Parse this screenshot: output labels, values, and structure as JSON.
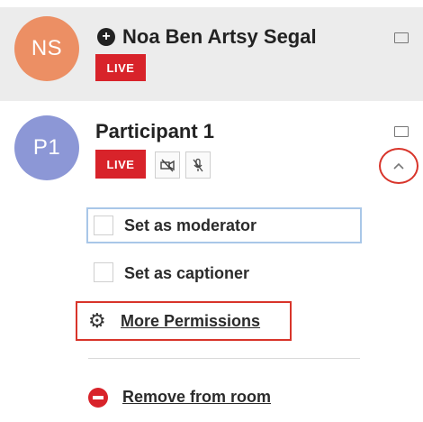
{
  "participants": [
    {
      "initials": "NS",
      "name": "Noa Ben Artsy Segal",
      "status": "LIVE",
      "avatar_color": "#ec8f64"
    },
    {
      "initials": "P1",
      "name": "Participant 1",
      "status": "LIVE",
      "avatar_color": "#8c97d6"
    }
  ],
  "menu": {
    "set_moderator": "Set as moderator",
    "set_captioner": "Set as captioner",
    "more_permissions": "More Permissions",
    "remove_from_room": "Remove from room"
  },
  "colors": {
    "live_badge": "#d8232a",
    "highlight": "#d8342a",
    "focus": "#a9c7e8"
  },
  "icons": {
    "moderator": "plus-circle-icon",
    "screen": "screen-share-icon",
    "camera_off": "camera-off-icon",
    "mic_off": "mic-off-icon",
    "collapse": "chevron-up-icon",
    "gear": "gear-icon",
    "remove": "minus-circle-icon"
  }
}
